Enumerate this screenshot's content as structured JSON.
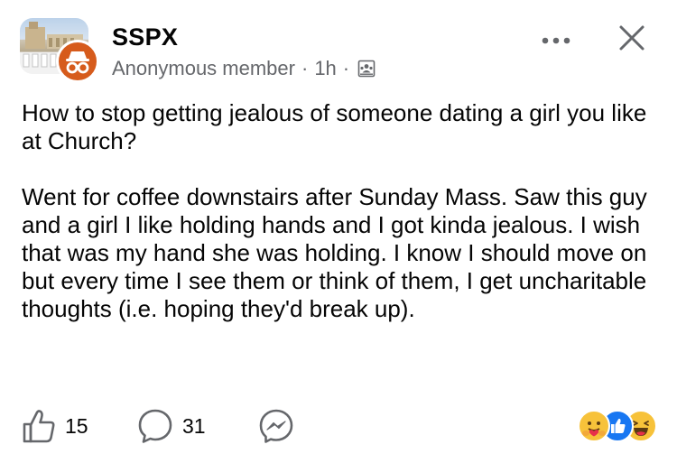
{
  "post": {
    "group_name": "SSPX",
    "author": "Anonymous member",
    "separator": "·",
    "time": "1h",
    "paragraphs": [
      "How to stop getting jealous of someone dating a girl you like at Church?",
      "Went for coffee downstairs after Sunday Mass. Saw this guy and a girl I like holding hands and I got kinda jealous. I wish that was my hand she was holding. I know I should move on but every time I see them or think of them, I get uncharitable thoughts (i.e. hoping they'd break up)."
    ]
  },
  "footer": {
    "likes": "15",
    "comments": "31"
  },
  "icons": {
    "more": "more-horizontal-icon",
    "close": "close-icon",
    "privacy": "group-privacy-icon",
    "like": "thumbs-up-icon",
    "comment": "comment-bubble-icon",
    "messenger": "messenger-icon",
    "reactions": [
      "care-reaction-icon",
      "like-reaction-icon",
      "haha-reaction-icon"
    ]
  },
  "colors": {
    "text": "#050505",
    "meta_text": "#65676b",
    "anon_avatar": "#d65b1c",
    "like_blue": "#1877f2",
    "reaction_yellow": "#f7c23a"
  }
}
